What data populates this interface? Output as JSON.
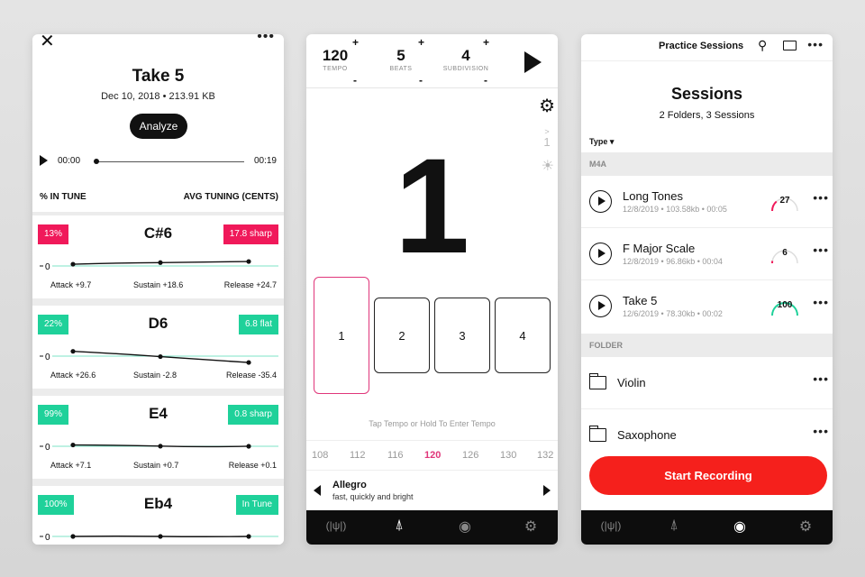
{
  "colors": {
    "pink": "#f0195a",
    "teal": "#1fd19a",
    "accent_pink": "#e0367a",
    "record_red": "#f5201c",
    "tabbar": "#0d0d0d"
  },
  "take": {
    "close_icon": "close-icon",
    "more_icon": "more-icon",
    "title": "Take 5",
    "subtitle": "Dec 10, 2018 • 213.91 KB",
    "analyze_label": "Analyze",
    "player": {
      "current": "00:00",
      "duration": "00:19"
    },
    "header_left": "% IN TUNE",
    "header_right": "AVG TUNING (CENTS)",
    "notes": [
      {
        "in_tune": "13%",
        "name": "C#6",
        "tuning": "17.8 sharp",
        "status": "sharp",
        "zero": "0",
        "attack": "Attack +9.7",
        "sustain": "Sustain +18.6",
        "release": "Release +24.7",
        "cents": [
          9.7,
          18.6,
          24.7
        ]
      },
      {
        "in_tune": "22%",
        "name": "D6",
        "tuning": "6.8 flat",
        "status": "flat",
        "zero": "0",
        "attack": "Attack +26.6",
        "sustain": "Sustain -2.8",
        "release": "Release -35.4",
        "cents": [
          26.6,
          -2.8,
          -35.4
        ]
      },
      {
        "in_tune": "99%",
        "name": "E4",
        "tuning": "0.8 sharp",
        "status": "sharp",
        "zero": "0",
        "attack": "Attack +7.1",
        "sustain": "Sustain +0.7",
        "release": "Release +0.1",
        "cents": [
          7.1,
          0.7,
          0.1
        ]
      },
      {
        "in_tune": "100%",
        "name": "Eb4",
        "tuning": "In Tune",
        "status": "in-tune",
        "zero": "0",
        "cents": [
          0,
          0,
          0
        ]
      }
    ]
  },
  "metronome": {
    "tempo": {
      "value": "120",
      "label": "TEMPO"
    },
    "beats": {
      "value": "5",
      "label": "BEATS"
    },
    "subdivision": {
      "value": "4",
      "label": "SUBDIVISION"
    },
    "plus": "+",
    "minus": "-",
    "current_beat": "1",
    "accent_arrow": ">",
    "accent_value": "1",
    "beat_boxes": [
      "1",
      "2",
      "3",
      "4"
    ],
    "active_beat": 0,
    "hint": "Tap Tempo or Hold To Enter Tempo",
    "tempo_ticks": [
      "108",
      "112",
      "116",
      "120",
      "126",
      "130",
      "132"
    ],
    "selected_tick": "120",
    "tempo_marking": {
      "name": "Allegro",
      "description": "fast, quickly and bright"
    }
  },
  "tabs": [
    {
      "icon": "tuner-icon",
      "glyph": "(|ψ|)"
    },
    {
      "icon": "metronome-icon",
      "glyph": "⍋"
    },
    {
      "icon": "record-icon",
      "glyph": "◉"
    },
    {
      "icon": "gear-icon",
      "glyph": "⚙"
    }
  ],
  "sessions": {
    "top_title": "Practice Sessions",
    "title": "Sessions",
    "subtitle": "2 Folders, 3 Sessions",
    "sort_label": "Type ▾",
    "section_m4a": "M4A",
    "section_folder": "FOLDER",
    "items": [
      {
        "name": "Long Tones",
        "meta": "12/8/2019 • 103.58kb • 00:05",
        "score": "27",
        "score_value": 27,
        "score_color": "#f0195a"
      },
      {
        "name": "F Major Scale",
        "meta": "12/8/2019 • 96.86kb • 00:04",
        "score": "6",
        "score_value": 6,
        "score_color": "#f0195a"
      },
      {
        "name": "Take 5",
        "meta": "12/6/2019 • 78.30kb • 00:02",
        "score": "100",
        "score_value": 100,
        "score_color": "#1fd19a"
      }
    ],
    "folders": [
      "Violin",
      "Saxophone"
    ],
    "record_label": "Start Recording",
    "more": "•••"
  }
}
